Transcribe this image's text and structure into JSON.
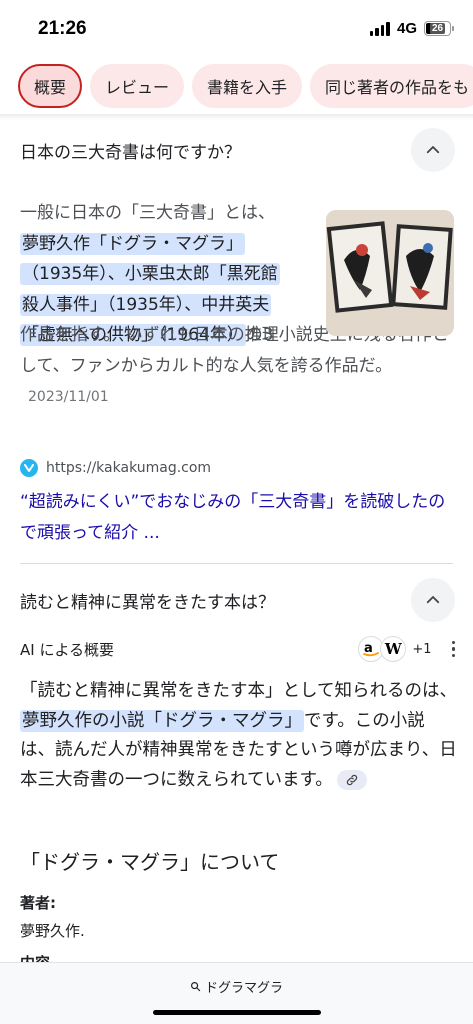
{
  "status_bar": {
    "time": "21:26",
    "network": "4G",
    "battery": "26"
  },
  "chips": [
    "概要",
    "レビュー",
    "書籍を入手",
    "同じ著者の作品をも"
  ],
  "question1": {
    "text": "日本の三大奇書は何ですか？",
    "answer_intro": "一般に日本の「三大奇書」とは、",
    "answer_hl1": "夢野久作「ドグラ・マグラ」",
    "answer_hl2": "（1935年）、小栗虫太郎「黒死館",
    "answer_hl3": "殺人事件」（1935年）、中井英夫",
    "answer_hl4": "「虚無への供物」（1964年）",
    "answer_after": "の3",
    "answer_rest": "作品を指す。 いずれも日本の推理小説史上に残る名作として、ファンからカルト的な人気を誇る作品だ。",
    "date": "2023/11/01",
    "source_url": "https://kakakumag.com",
    "link_title": "“超読みにくい”でおなじみの「三大奇書」を読破したので頑張って紹介 ..."
  },
  "question2": {
    "text": "読むと精神に異常をきたす本は？",
    "ai_label": "AI による概要",
    "sources_more": "+1",
    "answer_pre": "「読むと精神に異常をきたす本」として知られるのは、",
    "answer_hl": "夢野久作の小説「ドグラ・マグラ」",
    "answer_post": "です。この小説は、読んだ人が精神異常をきたすという噂が広まり、日本三大奇書の一つに数えられています。",
    "subheading": "「ドグラ・マグラ」について",
    "author_label": "著者:",
    "author_value": "夢野久作.",
    "next_label": "内容"
  },
  "bottom_bar": {
    "search_query": "ドグラマグラ"
  },
  "colors": {
    "chip_bg": "#fce8e9",
    "chip_active_border": "#c5221f",
    "highlight": "#d3e3fd",
    "link": "#1a0dab"
  }
}
